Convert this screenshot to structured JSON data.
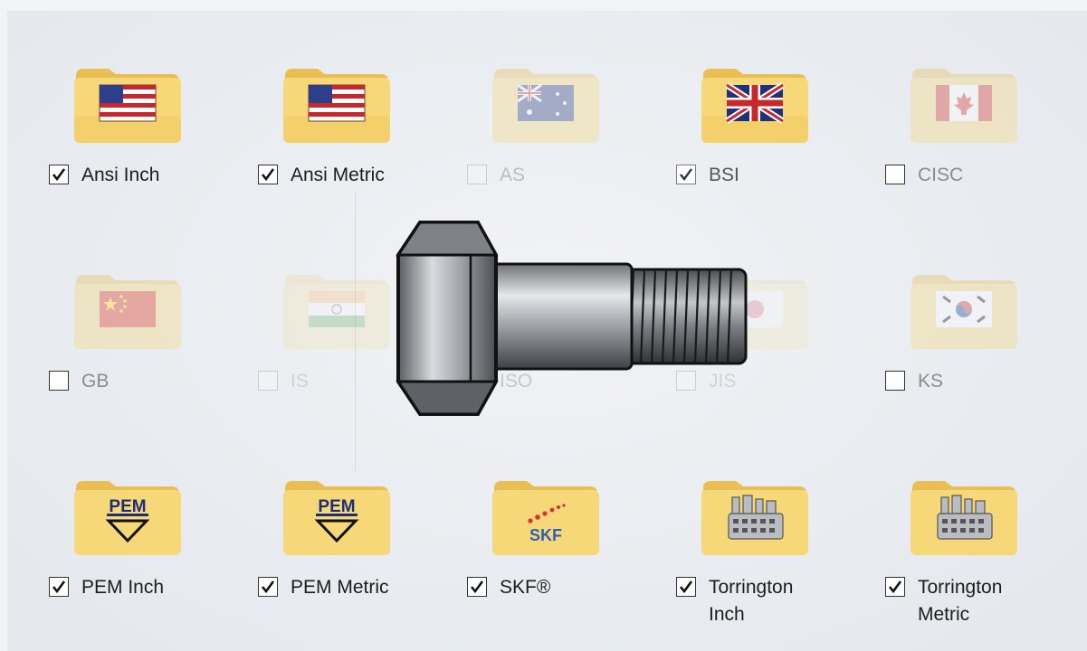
{
  "standards": [
    {
      "label": "Ansi Inch",
      "checked": true,
      "state": "enabled",
      "icon": "us-flag-icon"
    },
    {
      "label": "Ansi Metric",
      "checked": true,
      "state": "enabled",
      "icon": "us-flag-icon"
    },
    {
      "label": "AS",
      "checked": false,
      "state": "disabled",
      "icon": "australia-flag-icon"
    },
    {
      "label": "BSI",
      "checked": true,
      "state": "enabled",
      "icon": "uk-flag-icon"
    },
    {
      "label": "CISC",
      "checked": false,
      "state": "enabled",
      "icon": "canada-flag-icon"
    },
    {
      "label": "GB",
      "checked": false,
      "state": "enabled",
      "icon": "china-flag-icon"
    },
    {
      "label": "IS",
      "checked": false,
      "state": "disabled",
      "icon": "india-flag-icon"
    },
    {
      "label": "ISO",
      "checked": false,
      "state": "disabled",
      "icon": "iso-icon"
    },
    {
      "label": "JIS",
      "checked": false,
      "state": "disabled",
      "icon": "japan-flag-icon"
    },
    {
      "label": "KS",
      "checked": false,
      "state": "enabled",
      "icon": "korea-flag-icon"
    },
    {
      "label": "PEM Inch",
      "checked": true,
      "state": "enabled",
      "icon": "pem-logo-icon"
    },
    {
      "label": "PEM Metric",
      "checked": true,
      "state": "enabled",
      "icon": "pem-logo-icon"
    },
    {
      "label": "SKF®",
      "checked": true,
      "state": "enabled",
      "icon": "skf-logo-icon"
    },
    {
      "label": "Torrington Inch",
      "label_lines": [
        "Torrington",
        "Inch"
      ],
      "checked": true,
      "state": "enabled",
      "icon": "factory-icon"
    },
    {
      "label": "Torrington Metric",
      "label_lines": [
        "Torrington",
        "Metric"
      ],
      "checked": true,
      "state": "enabled",
      "icon": "factory-icon"
    }
  ],
  "overlay": {
    "icon": "bolt-icon"
  },
  "colors": {
    "folder": "#f5d472",
    "checkmark": "#111111",
    "disabled_text": "#b9bcc0"
  }
}
